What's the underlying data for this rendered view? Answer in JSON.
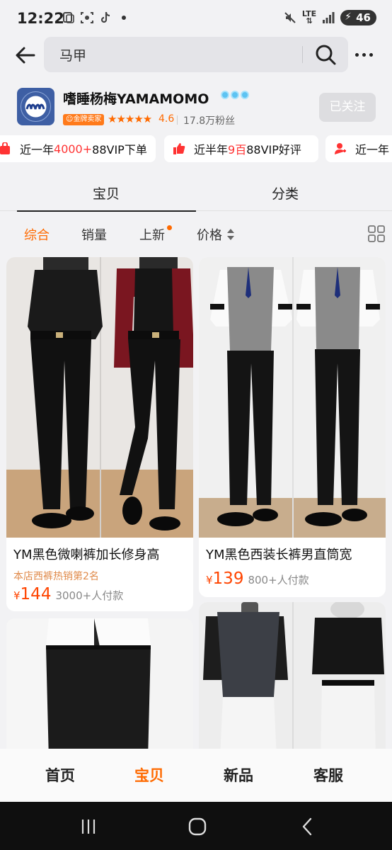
{
  "status_bar": {
    "time": "12:22",
    "network": "LTE",
    "battery": "46"
  },
  "search": {
    "query": "马甲",
    "back_icon": "arrow-left-icon",
    "search_icon": "magnifier-icon",
    "more_icon": "more-dots-icon"
  },
  "shop": {
    "name": "嗜睡杨梅YAMAMOMO",
    "badge": "金牌卖家",
    "rating": "4.6",
    "fans": "17.8万粉丝",
    "follow_label": "已关注",
    "logo_text": "YAMAMOMO"
  },
  "badges": [
    {
      "prefix": "近一年",
      "highlight": "4000+",
      "suffix": "88VIP下单",
      "icon": "bag-icon"
    },
    {
      "prefix": "近半年",
      "highlight": "9百",
      "suffix": "88VIP好评",
      "icon": "thumbs-up-icon"
    },
    {
      "prefix": "近一年",
      "highlight": "",
      "suffix": "",
      "icon": "user-icon"
    }
  ],
  "tabs": [
    {
      "label": "宝贝",
      "active": true
    },
    {
      "label": "分类",
      "active": false
    }
  ],
  "sort": {
    "items": [
      "综合",
      "销量",
      "上新",
      "价格"
    ],
    "active": "综合"
  },
  "products": [
    {
      "title": "YM黑色微喇裤加长修身高",
      "rank": "本店西裤热销第2名",
      "currency": "¥",
      "price": "144",
      "sold": "3000+人付款"
    },
    {
      "title": "YM黑色西装长裤男直筒宽",
      "rank": "",
      "currency": "¥",
      "price": "139",
      "sold": "800+人付款"
    },
    {
      "title": "",
      "rank": "",
      "currency": "",
      "price": "",
      "sold": ""
    },
    {
      "title": "",
      "rank": "",
      "currency": "",
      "price": "",
      "sold": ""
    }
  ],
  "bottom_nav": [
    "首页",
    "宝贝",
    "新品",
    "客服"
  ],
  "bottom_nav_active": "宝贝",
  "colors": {
    "accent": "#ff6a00",
    "price": "#ff4400",
    "highlight_red": "#ff3333"
  }
}
